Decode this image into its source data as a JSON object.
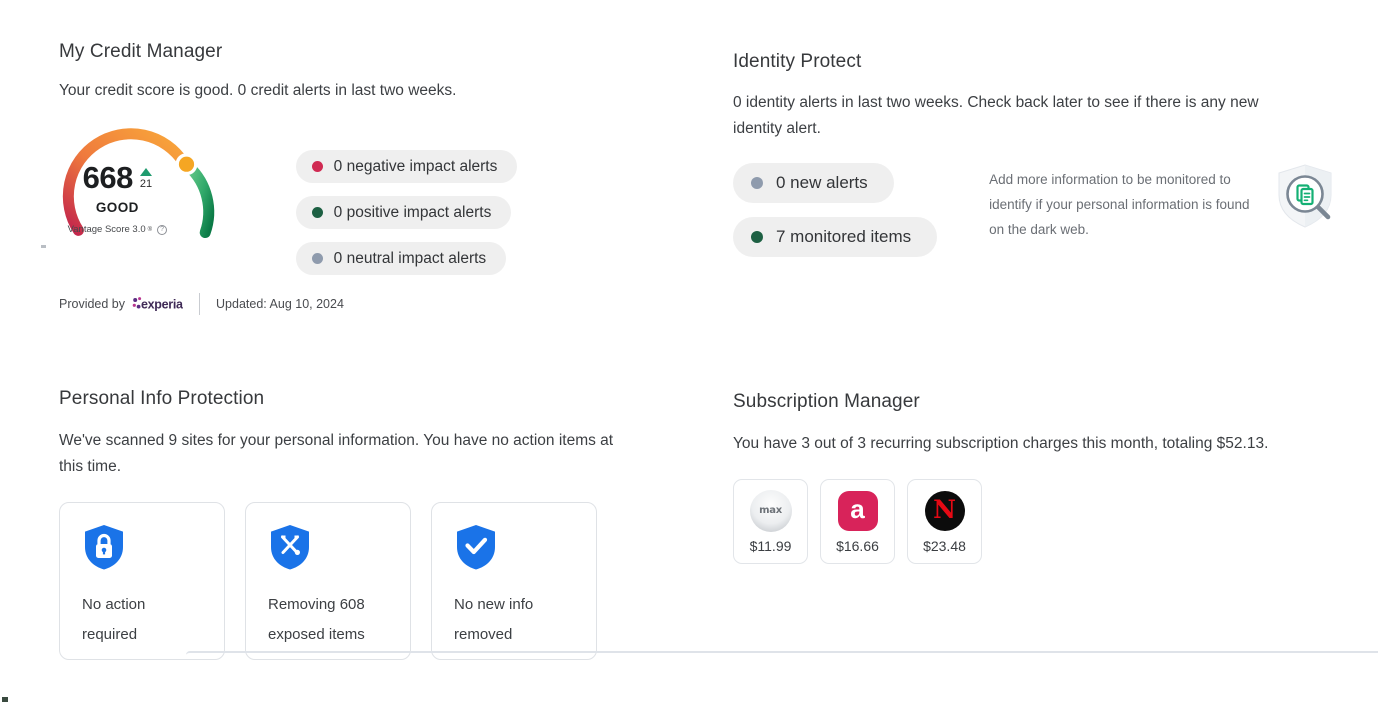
{
  "credit": {
    "title": "My Credit Manager",
    "subtitle": "Your credit score is good. 0 credit alerts in last two weeks.",
    "gauge": {
      "score": "668",
      "delta": "21",
      "delta_direction": "up",
      "rating": "GOOD",
      "model": "Vantage Score 3.0",
      "registered_mark": "®",
      "info_icon": "info-circle-icon",
      "range_min": 300,
      "range_max": 850,
      "arc_colors": [
        "#c2244c",
        "#f2a33c",
        "#f7b32b",
        "#3fbf7f",
        "#0f7b48"
      ],
      "knob_color": "#f5a623"
    },
    "alerts": [
      {
        "label": "0 negative impact alerts",
        "color": "#d02a52"
      },
      {
        "label": "0 positive impact alerts",
        "color": "#1d6043"
      },
      {
        "label": "0 neutral impact alerts",
        "color": "#8f9bad"
      }
    ],
    "footer": {
      "provided_by": "Provided by",
      "provider": "experian",
      "updated": "Updated: Aug 10, 2024"
    }
  },
  "identity": {
    "title": "Identity Protect",
    "subtitle": "0 identity alerts in last two weeks. Check back later to see if there is any new identity alert.",
    "pills": [
      {
        "label": "0 new alerts",
        "color": "#8f9bad"
      },
      {
        "label": "7 monitored items",
        "color": "#1d6043"
      }
    ],
    "note": "Add more information to be monitored to identify if your personal information is found on the dark web.",
    "note_icon": "shield-magnifier-document-icon"
  },
  "personal_info": {
    "title": "Personal Info Protection",
    "subtitle": "We've scanned 9 sites for your personal information. You have no action items at this time.",
    "cards": [
      {
        "icon": "shield-lock-icon",
        "line1": "No action",
        "line2": "required",
        "color": "#1a73e8"
      },
      {
        "icon": "shield-tools-icon",
        "line1": "Removing 608",
        "line2": "exposed items",
        "color": "#1a73e8"
      },
      {
        "icon": "shield-check-icon",
        "line1": "No new info",
        "line2": "removed",
        "color": "#1a73e8"
      }
    ]
  },
  "subscriptions": {
    "title": "Subscription Manager",
    "subtitle": "You have 3 out of 3 recurring subscription charges this month, totaling $52.13.",
    "items": [
      {
        "logo": "max-logo-icon",
        "name": "max",
        "amount": "$11.99"
      },
      {
        "logo": "audible-logo-icon",
        "name": "a",
        "amount": "$16.66"
      },
      {
        "logo": "netflix-logo-icon",
        "name": "N",
        "amount": "$23.48"
      }
    ]
  }
}
